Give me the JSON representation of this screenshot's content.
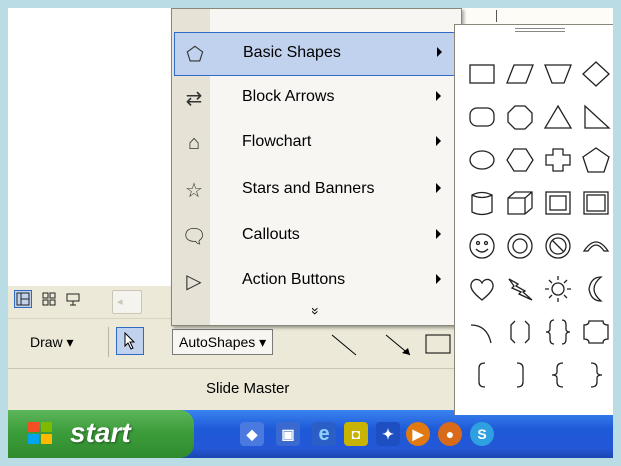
{
  "menu": {
    "items": [
      {
        "label": "Basic Shapes",
        "icon": "basic-shapes-icon",
        "has_submenu": true,
        "selected": true
      },
      {
        "label": "Block Arrows",
        "icon": "block-arrows-icon",
        "has_submenu": true
      },
      {
        "label": "Flowchart",
        "icon": "flowchart-icon",
        "has_submenu": true
      },
      {
        "label": "Stars and Banners",
        "icon": "stars-and-banners-icon",
        "has_submenu": true
      },
      {
        "label": "Callouts",
        "icon": "callouts-icon",
        "has_submenu": true
      },
      {
        "label": "Action Buttons",
        "icon": "action-buttons-icon",
        "has_submenu": true
      }
    ],
    "more_glyph": "»"
  },
  "submenu": {
    "shapes": [
      "rectangle",
      "parallelogram",
      "trapezoid",
      "diamond",
      "rounded-rectangle",
      "octagon",
      "isosceles-triangle",
      "right-triangle",
      "oval",
      "hexagon",
      "cross",
      "pentagon",
      "can",
      "cube",
      "bevel",
      "frame",
      "smiley-face",
      "donut",
      "no-symbol",
      "block-arc",
      "heart",
      "lightning-bolt",
      "sun",
      "moon",
      "arc",
      "double-bracket",
      "double-brace",
      "plaque",
      "left-bracket",
      "right-bracket",
      "left-brace",
      "right-brace"
    ]
  },
  "toolbar": {
    "draw_label": "Draw ▾",
    "autoshapes_label": "AutoShapes ▾",
    "pointer_icon": "pointer-icon"
  },
  "view_bar": {
    "buttons": [
      "normal-view-icon",
      "slide-sorter-icon",
      "slide-show-icon"
    ]
  },
  "status": {
    "slide_master_label": "Slide Master"
  },
  "taskbar": {
    "start_label": "start",
    "quick_launch": [
      "quick-launch-1",
      "quick-launch-2",
      "internet-explorer-icon",
      "quick-launch-4",
      "media-player-icon",
      "firefox-icon",
      "skype-icon"
    ]
  }
}
